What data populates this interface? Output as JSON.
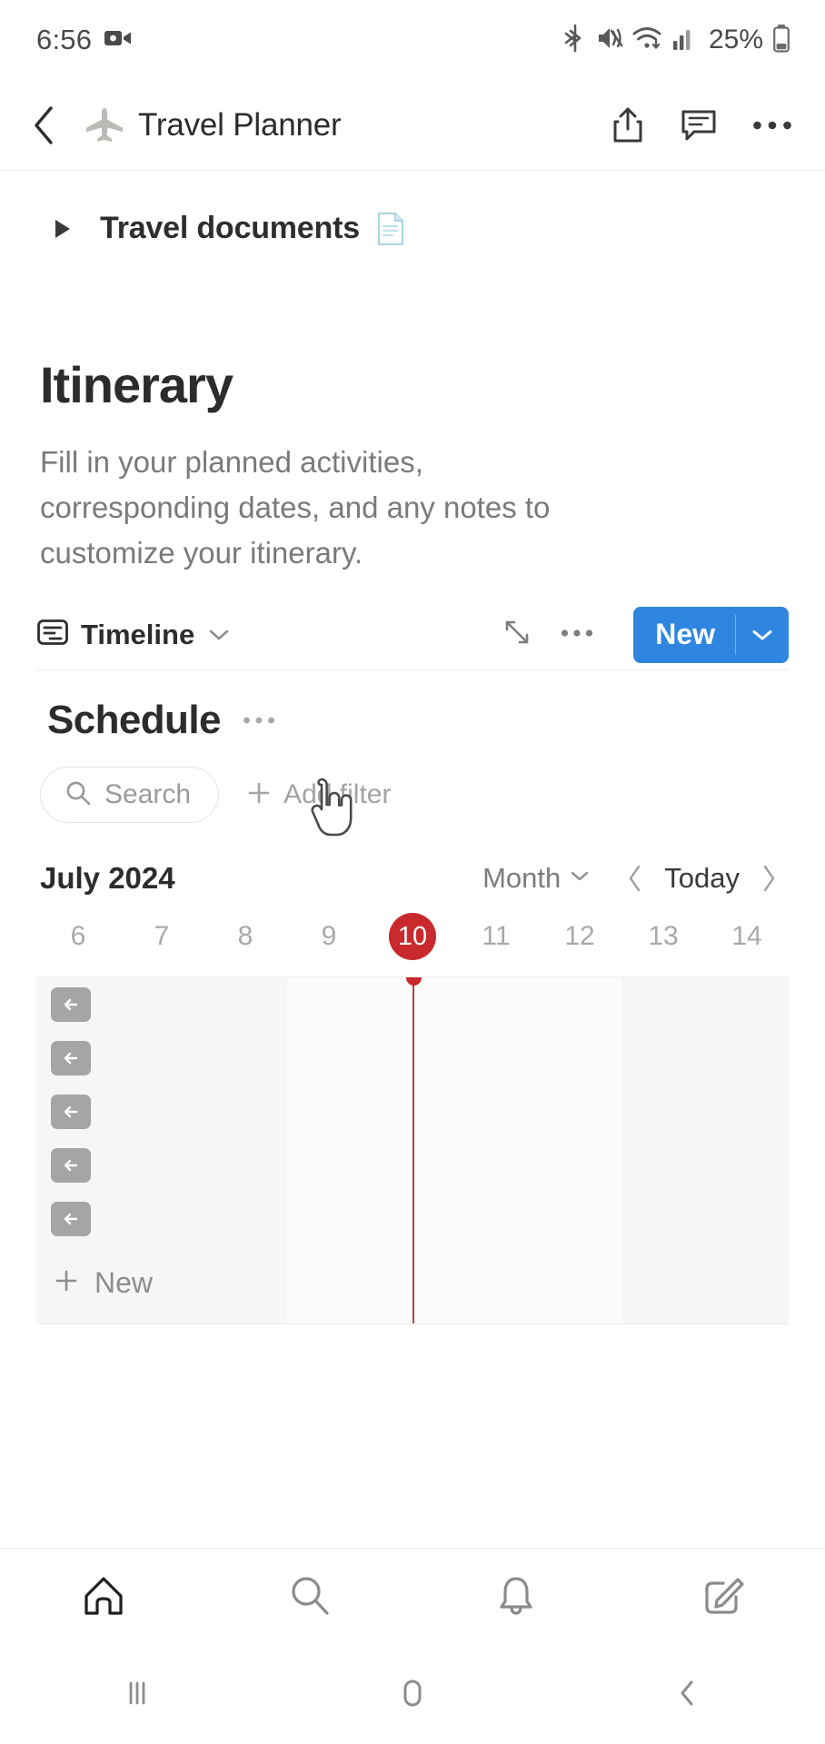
{
  "status_bar": {
    "time": "6:56",
    "battery_percent": "25%",
    "icons": [
      "screen-record-icon",
      "bluetooth-icon",
      "vibrate-mute-icon",
      "wifi-icon",
      "cellular-signal-icon",
      "battery-icon"
    ]
  },
  "app_bar": {
    "back_label": "back-chevron",
    "page_emoji": "airplane-icon",
    "title": "Travel Planner",
    "actions": [
      "share-icon",
      "comment-icon",
      "more-options-icon"
    ]
  },
  "page": {
    "toggle": {
      "label": "Travel documents",
      "expanded": false,
      "trailing_icon": "page-document-icon"
    },
    "heading": "Itinerary",
    "description": "Fill in your planned activities, corresponding dates, and any notes to customize your itinerary."
  },
  "view_bar": {
    "view_icon": "timeline-view-icon",
    "view_name": "Timeline",
    "expand_icon": "expand-diagonal-icon",
    "more_icon": "more-options-icon",
    "new_label": "New",
    "new_caret_icon": "chevron-down-icon"
  },
  "database": {
    "title": "Schedule",
    "title_more_icon": "more-options-icon",
    "search_placeholder": "Search",
    "search_icon": "search-icon",
    "add_filter_label": "Add filter",
    "add_filter_icon": "plus-icon"
  },
  "calendar": {
    "month_label": "July 2024",
    "scale": "Month",
    "scale_caret_icon": "chevron-down-icon",
    "prev_icon": "chevron-left-icon",
    "today_label": "Today",
    "next_icon": "chevron-right-icon",
    "days": [
      "6",
      "7",
      "8",
      "9",
      "10",
      "11",
      "12",
      "13",
      "14"
    ],
    "today_day": "10",
    "today_index": 4,
    "today_marker_color": "#c9292c",
    "rows": [
      {
        "chip_icon": "arrow-left-icon"
      },
      {
        "chip_icon": "arrow-left-icon"
      },
      {
        "chip_icon": "arrow-left-icon"
      },
      {
        "chip_icon": "arrow-left-icon"
      },
      {
        "chip_icon": "arrow-left-icon"
      }
    ],
    "new_row_label": "New",
    "new_row_icon": "plus-icon"
  },
  "bottom_nav": {
    "items": [
      {
        "name": "home",
        "icon": "home-icon",
        "active": true
      },
      {
        "name": "search",
        "icon": "search-icon",
        "active": false
      },
      {
        "name": "inbox",
        "icon": "bell-icon",
        "active": false
      },
      {
        "name": "new-note",
        "icon": "compose-icon",
        "active": false
      }
    ]
  },
  "android_nav": {
    "items": [
      {
        "name": "recents",
        "icon": "recents-icon"
      },
      {
        "name": "home",
        "icon": "home-pill-icon"
      },
      {
        "name": "back",
        "icon": "back-chevron-icon"
      }
    ]
  },
  "cursor": {
    "type": "pointing-hand-cursor"
  },
  "colors": {
    "accent_blue": "#2f86e0",
    "today_red": "#c9292c",
    "text_primary": "#2c2c2c",
    "text_muted": "#7a7a7a"
  }
}
